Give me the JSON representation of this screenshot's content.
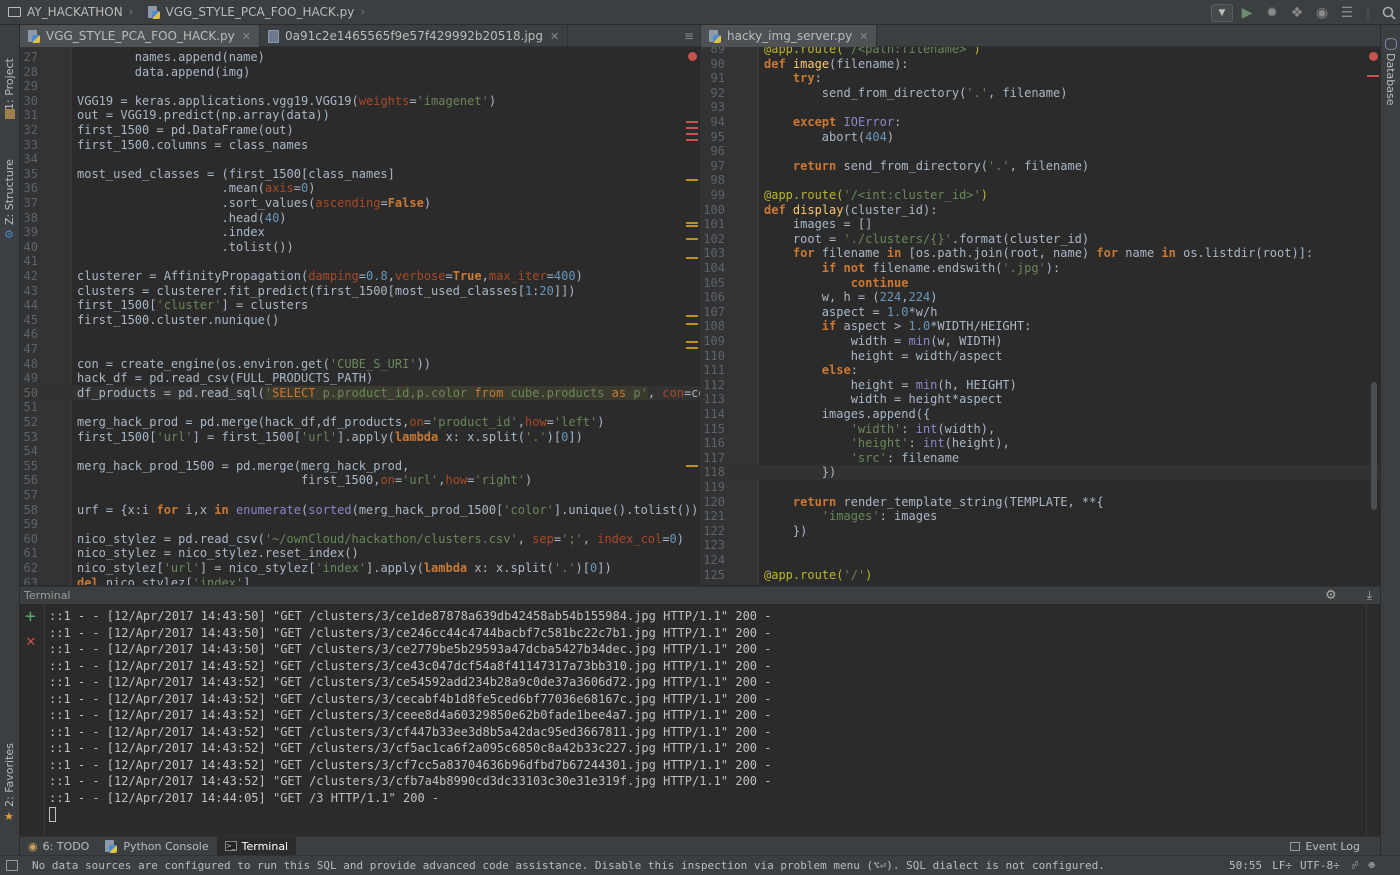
{
  "nav": {
    "project": "AY_HACKATHON",
    "file": "VGG_STYLE_PCA_FOO_HACK.py"
  },
  "side_tabs_left": [
    "1: Project",
    "Z: Structure",
    "2: Favorites"
  ],
  "side_tabs_right": [
    "Database"
  ],
  "left_tabs": [
    {
      "label": "VGG_STYLE_PCA_FOO_HACK.py",
      "icon": "python-file-icon",
      "active": true
    },
    {
      "label": "0a91c2e1465565f9e57f429992b20518.jpg",
      "icon": "image-file-icon",
      "active": false
    }
  ],
  "left_tabs_extra": "≡",
  "right_tabs": [
    {
      "label": "hacky_img_server.py",
      "icon": "python-file-icon",
      "active": true
    }
  ],
  "left_code": {
    "start": 27,
    "lines": [
      [
        [
          "",
          "        names.append(name)"
        ]
      ],
      [
        [
          "",
          "        data.append(img)"
        ]
      ],
      [],
      [
        [
          "",
          "VGG19 = keras.applications.vgg19.VGG19("
        ],
        [
          "par",
          "weights"
        ],
        [
          "",
          "="
        ],
        [
          "str",
          "'imagenet'"
        ],
        [
          "",
          ")"
        ]
      ],
      [
        [
          "",
          "out = VGG19.predict(np.array(data))"
        ]
      ],
      [
        [
          "",
          "first_1500 = pd.DataFrame(out)"
        ]
      ],
      [
        [
          "",
          "first_1500.columns = class_names"
        ]
      ],
      [],
      [
        [
          "",
          "most_used_classes = (first_1500[class_names]"
        ]
      ],
      [
        [
          "",
          "                    .mean("
        ],
        [
          "par",
          "axis"
        ],
        [
          "",
          "="
        ],
        [
          "num",
          "0"
        ],
        [
          "",
          ")"
        ]
      ],
      [
        [
          "",
          "                    .sort_values("
        ],
        [
          "par",
          "ascending"
        ],
        [
          "",
          "="
        ],
        [
          "kw",
          "False"
        ],
        [
          "",
          ")"
        ]
      ],
      [
        [
          "",
          "                    .head("
        ],
        [
          "num",
          "40"
        ],
        [
          "",
          ")"
        ]
      ],
      [
        [
          "",
          "                    .index"
        ]
      ],
      [
        [
          "",
          "                    .tolist())"
        ]
      ],
      [],
      [
        [
          "",
          "clusterer = AffinityPropagation("
        ],
        [
          "par",
          "damping"
        ],
        [
          "",
          "="
        ],
        [
          "num",
          "0.8"
        ],
        [
          "",
          ","
        ],
        [
          "par",
          "verbose"
        ],
        [
          "",
          "="
        ],
        [
          "kw",
          "True"
        ],
        [
          "",
          ","
        ],
        [
          "par",
          "max_iter"
        ],
        [
          "",
          "="
        ],
        [
          "num",
          "400"
        ],
        [
          "",
          ")"
        ]
      ],
      [
        [
          "",
          "clusters = clusterer.fit_predict(first_1500[most_used_classes["
        ],
        [
          "num",
          "1"
        ],
        [
          "",
          ":"
        ],
        [
          "num",
          "20"
        ],
        [
          "",
          "]])"
        ]
      ],
      [
        [
          "",
          "first_1500["
        ],
        [
          "str",
          "'cluster'"
        ],
        [
          "",
          "] = clusters"
        ]
      ],
      [
        [
          "",
          "first_1500.cluster.nunique()"
        ]
      ],
      [],
      [],
      [
        [
          "",
          "con = create_engine(os.environ.get("
        ],
        [
          "str",
          "'CUBE_S_URI'"
        ],
        [
          "",
          "))"
        ]
      ],
      [
        [
          "",
          "hack_df = pd.read_csv(FULL_PRODUCTS_PATH)"
        ]
      ],
      [
        [
          "",
          "df_products = pd.read_sql("
        ],
        [
          "sqls",
          "'"
        ],
        [
          "sqlk",
          "SELECT"
        ],
        [
          "sqls",
          " p.product_id,p.color "
        ],
        [
          "sqlk",
          "from"
        ],
        [
          "sqls",
          " cube.products "
        ],
        [
          "sqlk",
          "as"
        ],
        [
          "sqls",
          " p'"
        ],
        [
          "",
          ", "
        ],
        [
          "par",
          "con"
        ],
        [
          "",
          "=con)"
        ]
      ],
      [],
      [
        [
          "",
          "merg_hack_prod = pd.merge(hack_df,df_products,"
        ],
        [
          "par",
          "on"
        ],
        [
          "",
          "="
        ],
        [
          "str",
          "'product_id'"
        ],
        [
          "",
          ","
        ],
        [
          "par",
          "how"
        ],
        [
          "",
          "="
        ],
        [
          "str",
          "'left'"
        ],
        [
          "",
          ")"
        ]
      ],
      [
        [
          "",
          "first_1500["
        ],
        [
          "str",
          "'url'"
        ],
        [
          "",
          "] = first_1500["
        ],
        [
          "str",
          "'url'"
        ],
        [
          "",
          "].apply("
        ],
        [
          "kw",
          "lambda"
        ],
        [
          "",
          " x: x.split("
        ],
        [
          "str",
          "'.'"
        ],
        [
          "",
          ")["
        ],
        [
          "num",
          "0"
        ],
        [
          "",
          "])"
        ]
      ],
      [],
      [
        [
          "",
          "merg_hack_prod_1500 = pd.merge(merg_hack_prod,"
        ]
      ],
      [
        [
          "",
          "                               first_1500,"
        ],
        [
          "par",
          "on"
        ],
        [
          "",
          "="
        ],
        [
          "str",
          "'url'"
        ],
        [
          "",
          ","
        ],
        [
          "par",
          "how"
        ],
        [
          "",
          "="
        ],
        [
          "str",
          "'right'"
        ],
        [
          "",
          ")"
        ]
      ],
      [],
      [
        [
          "",
          "urf = {x:i "
        ],
        [
          "kw",
          "for"
        ],
        [
          "",
          " i,x "
        ],
        [
          "kw",
          "in"
        ],
        [
          "",
          " "
        ],
        [
          "bi",
          "enumerate"
        ],
        [
          "",
          "("
        ],
        [
          "bi",
          "sorted"
        ],
        [
          "",
          "(merg_hack_prod_1500["
        ],
        [
          "str",
          "'color'"
        ],
        [
          "",
          "].unique().tolist()))}"
        ]
      ],
      [],
      [
        [
          "",
          "nico_stylez = pd.read_csv("
        ],
        [
          "str",
          "'~/ownCloud/hackathon/clusters.csv'"
        ],
        [
          "",
          ", "
        ],
        [
          "par",
          "sep"
        ],
        [
          "",
          "="
        ],
        [
          "str",
          "';'"
        ],
        [
          "",
          ", "
        ],
        [
          "par",
          "index_col"
        ],
        [
          "",
          "="
        ],
        [
          "num",
          "0"
        ],
        [
          "",
          ")"
        ]
      ],
      [
        [
          "",
          "nico_stylez = nico_stylez.reset_index()"
        ]
      ],
      [
        [
          "",
          "nico_stylez["
        ],
        [
          "str",
          "'url'"
        ],
        [
          "",
          "] = nico_stylez["
        ],
        [
          "str",
          "'index'"
        ],
        [
          "",
          "].apply("
        ],
        [
          "kw",
          "lambda"
        ],
        [
          "",
          " x: x.split("
        ],
        [
          "str",
          "'.'"
        ],
        [
          "",
          ")["
        ],
        [
          "num",
          "0"
        ],
        [
          "",
          "])"
        ]
      ],
      [
        [
          "kw",
          "del"
        ],
        [
          "",
          " nico_stylez["
        ],
        [
          "str",
          "'index'"
        ],
        [
          "",
          "]"
        ]
      ]
    ]
  },
  "right_code": {
    "start": 89,
    "lines": [
      [
        [
          "dec",
          "@app.route("
        ],
        [
          "str",
          "'/<path:filename>'"
        ],
        [
          "dec",
          ")"
        ]
      ],
      [
        [
          "kw",
          "def"
        ],
        [
          "",
          " "
        ],
        [
          "fnn",
          "image"
        ],
        [
          "",
          "(filename):"
        ]
      ],
      [
        [
          "",
          "    "
        ],
        [
          "kw",
          "try"
        ],
        [
          "",
          ":"
        ]
      ],
      [
        [
          "",
          "        send_from_directory("
        ],
        [
          "str",
          "'.'"
        ],
        [
          "",
          ", filename)"
        ]
      ],
      [],
      [
        [
          "",
          "    "
        ],
        [
          "kw",
          "except"
        ],
        [
          "",
          " "
        ],
        [
          "bi",
          "IOError"
        ],
        [
          "",
          ":"
        ]
      ],
      [
        [
          "",
          "        abort("
        ],
        [
          "num",
          "404"
        ],
        [
          "",
          ")"
        ]
      ],
      [],
      [
        [
          "",
          "    "
        ],
        [
          "kw",
          "return"
        ],
        [
          "",
          " send_from_directory("
        ],
        [
          "str",
          "'.'"
        ],
        [
          "",
          ", filename)"
        ]
      ],
      [],
      [
        [
          "dec",
          "@app.route("
        ],
        [
          "str",
          "'/<int:cluster_id>'"
        ],
        [
          "dec",
          ")"
        ]
      ],
      [
        [
          "kw",
          "def"
        ],
        [
          "",
          " "
        ],
        [
          "fnn",
          "display"
        ],
        [
          "",
          "(cluster_id):"
        ]
      ],
      [
        [
          "",
          "    images = []"
        ]
      ],
      [
        [
          "",
          "    root = "
        ],
        [
          "str",
          "'./clusters/{}'"
        ],
        [
          "",
          ".format(cluster_id)"
        ]
      ],
      [
        [
          "",
          "    "
        ],
        [
          "kw",
          "for"
        ],
        [
          "",
          " filename "
        ],
        [
          "kw",
          "in"
        ],
        [
          "",
          " [os.path.join(root, name) "
        ],
        [
          "kw",
          "for"
        ],
        [
          "",
          " name "
        ],
        [
          "kw",
          "in"
        ],
        [
          "",
          " os.listdir(root)]:"
        ]
      ],
      [
        [
          "",
          "        "
        ],
        [
          "kw",
          "if not"
        ],
        [
          "",
          " filename.endswith("
        ],
        [
          "str",
          "'.jpg'"
        ],
        [
          "",
          "):"
        ]
      ],
      [
        [
          "",
          "            "
        ],
        [
          "kw",
          "continue"
        ]
      ],
      [
        [
          "",
          "        w, h = ("
        ],
        [
          "num",
          "224"
        ],
        [
          "",
          ","
        ],
        [
          "num",
          "224"
        ],
        [
          "",
          ")"
        ]
      ],
      [
        [
          "",
          "        aspect = "
        ],
        [
          "num",
          "1.0"
        ],
        [
          "",
          "*w/h"
        ]
      ],
      [
        [
          "",
          "        "
        ],
        [
          "kw",
          "if"
        ],
        [
          "",
          " aspect > "
        ],
        [
          "num",
          "1.0"
        ],
        [
          "",
          "*WIDTH/HEIGHT:"
        ]
      ],
      [
        [
          "",
          "            width = "
        ],
        [
          "bi",
          "min"
        ],
        [
          "",
          "(w, WIDTH)"
        ]
      ],
      [
        [
          "",
          "            height = width/aspect"
        ]
      ],
      [
        [
          "",
          "        "
        ],
        [
          "kw",
          "else"
        ],
        [
          "",
          ":"
        ]
      ],
      [
        [
          "",
          "            height = "
        ],
        [
          "bi",
          "min"
        ],
        [
          "",
          "(h, HEIGHT)"
        ]
      ],
      [
        [
          "",
          "            width = height*aspect"
        ]
      ],
      [
        [
          "",
          "        images.append({"
        ]
      ],
      [
        [
          "",
          "            "
        ],
        [
          "str",
          "'width'"
        ],
        [
          "",
          ": "
        ],
        [
          "bi",
          "int"
        ],
        [
          "",
          "(width),"
        ]
      ],
      [
        [
          "",
          "            "
        ],
        [
          "str",
          "'height'"
        ],
        [
          "",
          ": "
        ],
        [
          "bi",
          "int"
        ],
        [
          "",
          "(height),"
        ]
      ],
      [
        [
          "",
          "            "
        ],
        [
          "str",
          "'src'"
        ],
        [
          "",
          ": filename"
        ]
      ],
      [
        [
          "",
          "        })"
        ]
      ],
      [],
      [
        [
          "",
          "    "
        ],
        [
          "kw",
          "return"
        ],
        [
          "",
          " render_template_string(TEMPLATE, **{"
        ]
      ],
      [
        [
          "",
          "        "
        ],
        [
          "str",
          "'images'"
        ],
        [
          "",
          ": images"
        ]
      ],
      [
        [
          "",
          "    })"
        ]
      ],
      [],
      [],
      [
        [
          "dec",
          "@app.route("
        ],
        [
          "str",
          "'/'"
        ],
        [
          "dec",
          ")"
        ]
      ]
    ]
  },
  "terminal": {
    "title": "Terminal",
    "lines": [
      "::1 - - [12/Apr/2017 14:43:50] \"GET /clusters/3/ce1de87878a639db42458ab54b155984.jpg HTTP/1.1\" 200 -",
      "::1 - - [12/Apr/2017 14:43:50] \"GET /clusters/3/ce246cc44c4744bacbf7c581bc22c7b1.jpg HTTP/1.1\" 200 -",
      "::1 - - [12/Apr/2017 14:43:50] \"GET /clusters/3/ce2779be5b29593a47dcba5427b34dec.jpg HTTP/1.1\" 200 -",
      "::1 - - [12/Apr/2017 14:43:52] \"GET /clusters/3/ce43c047dcf54a8f41147317a73bb310.jpg HTTP/1.1\" 200 -",
      "::1 - - [12/Apr/2017 14:43:52] \"GET /clusters/3/ce54592add234b28a9c0de37a3606d72.jpg HTTP/1.1\" 200 -",
      "::1 - - [12/Apr/2017 14:43:52] \"GET /clusters/3/cecabf4b1d8fe5ced6bf77036e68167c.jpg HTTP/1.1\" 200 -",
      "::1 - - [12/Apr/2017 14:43:52] \"GET /clusters/3/ceee8d4a60329850e62b0fade1bee4a7.jpg HTTP/1.1\" 200 -",
      "::1 - - [12/Apr/2017 14:43:52] \"GET /clusters/3/cf447b33ee3d8b5a42dac95ed3667811.jpg HTTP/1.1\" 200 -",
      "::1 - - [12/Apr/2017 14:43:52] \"GET /clusters/3/cf5ac1ca6f2a095c6850c8a42b33c227.jpg HTTP/1.1\" 200 -",
      "::1 - - [12/Apr/2017 14:43:52] \"GET /clusters/3/cf7cc5a83704636b96dfbd7b67244301.jpg HTTP/1.1\" 200 -",
      "::1 - - [12/Apr/2017 14:43:52] \"GET /clusters/3/cfb7a4b8990cd3dc33103c30e31e319f.jpg HTTP/1.1\" 200 -",
      "::1 - - [12/Apr/2017 14:44:05] \"GET /3 HTTP/1.1\" 200 -"
    ]
  },
  "tool_tabs": [
    {
      "label": "6: TODO",
      "icon": "todo-icon",
      "active": false
    },
    {
      "label": "Python Console",
      "icon": "python-console-icon",
      "active": false
    },
    {
      "label": "Terminal",
      "icon": "terminal-icon",
      "active": true
    }
  ],
  "event_log": "Event Log",
  "status": {
    "message": "No data sources are configured to run this SQL and provide advanced code assistance. Disable this inspection via problem menu (⌥⏎). SQL dialect is not configured.",
    "position": "50:55",
    "line_sep": "LF÷",
    "encoding": "UTF-8÷"
  },
  "colors": {
    "error": "#c75450",
    "warning": "#be9117",
    "added": "#384c38",
    "accent": "#4a88c7"
  }
}
